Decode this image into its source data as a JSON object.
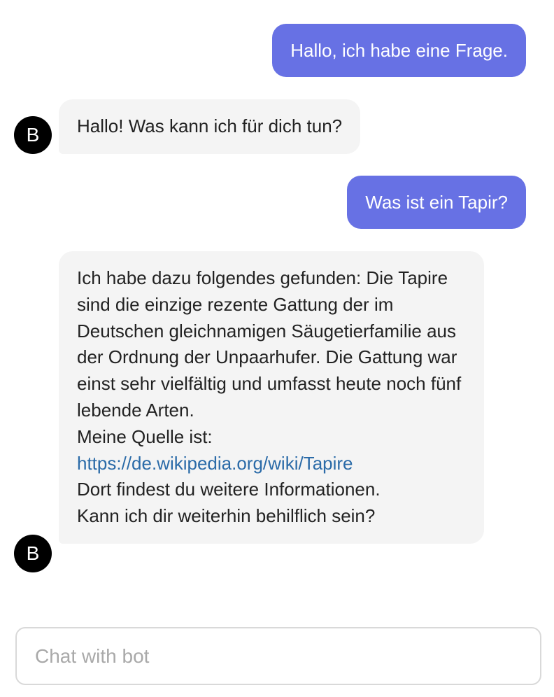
{
  "messages": [
    {
      "sender": "user",
      "text": "Hallo, ich habe eine Frage."
    },
    {
      "sender": "bot",
      "avatar": "B",
      "text": "Hallo! Was kann ich für dich tun?"
    },
    {
      "sender": "user",
      "text": "Was ist ein Tapir?"
    },
    {
      "sender": "bot",
      "avatar": "B",
      "lines": [
        "Ich habe dazu folgendes gefunden: Die Tapire sind die einzige rezente Gattung der im Deutschen gleichnamigen Säugetierfamilie aus der Ordnung der Unpaarhufer. Die Gattung war einst sehr vielfältig und umfasst heute noch fünf lebende Arten.",
        "Meine Quelle ist:",
        "Dort findest du weitere Informationen.",
        "Kann ich dir weiterhin behilflich sein?"
      ],
      "link": "https://de.wikipedia.org/wiki/Tapire"
    }
  ],
  "composer": {
    "placeholder": "Chat with bot",
    "value": ""
  },
  "colors": {
    "user_bubble": "#6771e4",
    "bot_bubble": "#f4f4f4",
    "link": "#2b6ba8",
    "avatar": "#000000"
  }
}
